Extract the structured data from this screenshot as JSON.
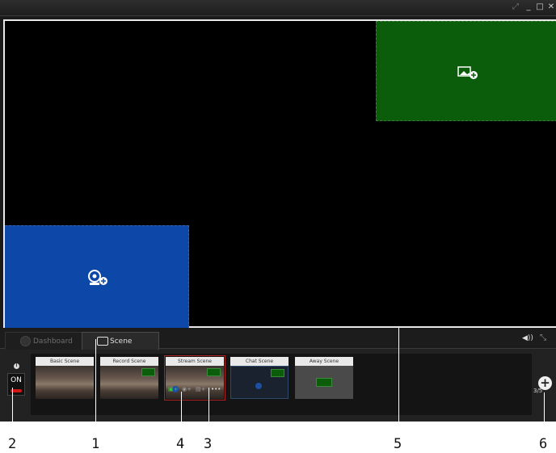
{
  "window": {
    "controls": [
      "pin-icon",
      "minimize-icon",
      "maximize-icon",
      "close-icon"
    ]
  },
  "tabs": [
    {
      "label": "Dashboard",
      "icon": "dashboard-icon",
      "active": false
    },
    {
      "label": "Scene",
      "icon": "scene-icon",
      "active": true
    }
  ],
  "stream_toggle": {
    "label": "ON",
    "state": "on"
  },
  "scenes": [
    {
      "label": "Basic Scene",
      "thumbnail": "image"
    },
    {
      "label": "Record Scene",
      "thumbnail": "image"
    },
    {
      "label": "Stream Scene",
      "thumbnail": "image",
      "selected": true
    },
    {
      "label": "Chat Scene",
      "thumbnail": "dark"
    },
    {
      "label": "Away Scene",
      "thumbnail": "gray"
    }
  ],
  "scene_toolbar": {
    "more_label": "•••"
  },
  "scene_count": "3/5",
  "callouts": {
    "c1": "1",
    "c2": "2",
    "c3": "3",
    "c4": "4",
    "c5": "5",
    "c6": "6"
  },
  "colors": {
    "image_source": "#0b5c0b",
    "webcam_source": "#0d47a8",
    "stream_on": "#d01818"
  }
}
